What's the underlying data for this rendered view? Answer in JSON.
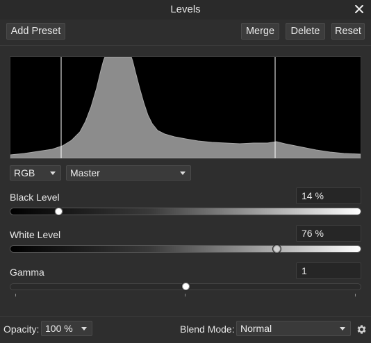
{
  "window": {
    "title": "Levels"
  },
  "toolbar": {
    "add_preset": "Add Preset",
    "merge": "Merge",
    "delete": "Delete",
    "reset": "Reset"
  },
  "channel_select": {
    "value": "RGB"
  },
  "mode_select": {
    "value": "Master"
  },
  "black_level": {
    "label": "Black Level",
    "value": "14 %",
    "fraction": 0.14
  },
  "white_level": {
    "label": "White Level",
    "value": "76 %",
    "fraction": 0.76
  },
  "gamma": {
    "label": "Gamma",
    "value": "1",
    "fraction": 0.5
  },
  "footer": {
    "opacity_label": "Opacity:",
    "opacity_value": "100 %",
    "blend_label": "Blend Mode:",
    "blend_value": "Normal"
  },
  "icons": {
    "close": "close-icon",
    "settings": "gear-icon"
  },
  "colors": {
    "background": "#2e2e2e",
    "histogram_fill": "#8c8c8c",
    "histogram_bg": "#000000"
  }
}
